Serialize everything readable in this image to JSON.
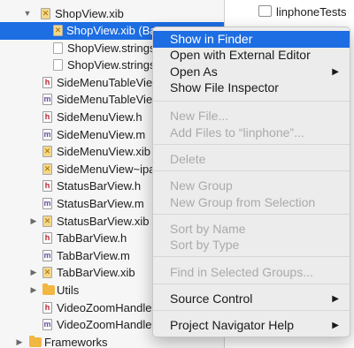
{
  "navigator": {
    "rows": [
      {
        "label": "ShopView.xib",
        "icon": "xib",
        "disclosure": "open"
      },
      {
        "label": "ShopView.xib (Bas",
        "icon": "xib",
        "selected": true
      },
      {
        "label": "ShopView.strings (",
        "icon": "strings"
      },
      {
        "label": "ShopView.strings (",
        "icon": "strings"
      },
      {
        "label": "SideMenuTableView.h",
        "icon": "h"
      },
      {
        "label": "SideMenuTableView.m",
        "icon": "m"
      },
      {
        "label": "SideMenuView.h",
        "icon": "h"
      },
      {
        "label": "SideMenuView.m",
        "icon": "m"
      },
      {
        "label": "SideMenuView.xib",
        "icon": "xib"
      },
      {
        "label": "SideMenuView~ipad.",
        "icon": "xib"
      },
      {
        "label": "StatusBarView.h",
        "icon": "h"
      },
      {
        "label": "StatusBarView.m",
        "icon": "m"
      },
      {
        "label": "StatusBarView.xib",
        "icon": "xib",
        "disclosure": "closed"
      },
      {
        "label": "TabBarView.h",
        "icon": "h"
      },
      {
        "label": "TabBarView.m",
        "icon": "m"
      },
      {
        "label": "TabBarView.xib",
        "icon": "xib",
        "disclosure": "closed"
      },
      {
        "label": "Utils",
        "icon": "folder",
        "disclosure": "closed"
      },
      {
        "label": "VideoZoomHandler.h",
        "icon": "h"
      },
      {
        "label": "VideoZoomHandler.m",
        "icon": "m"
      },
      {
        "label": "Frameworks",
        "icon": "folder",
        "disclosure": "closed"
      }
    ]
  },
  "editor": {
    "linphone_tests_label": "linphoneTests"
  },
  "context_menu": {
    "items": [
      {
        "label": "Show in Finder",
        "state": "highlight"
      },
      {
        "label": "Open with External Editor",
        "state": "enabled"
      },
      {
        "label": "Open As",
        "state": "enabled",
        "submenu": true
      },
      {
        "label": "Show File Inspector",
        "state": "enabled"
      },
      {
        "type": "separator"
      },
      {
        "label": "New File...",
        "state": "disabled"
      },
      {
        "label": "Add Files to “linphone”...",
        "state": "disabled"
      },
      {
        "type": "separator"
      },
      {
        "label": "Delete",
        "state": "disabled"
      },
      {
        "type": "separator"
      },
      {
        "label": "New Group",
        "state": "disabled"
      },
      {
        "label": "New Group from Selection",
        "state": "disabled"
      },
      {
        "type": "separator"
      },
      {
        "label": "Sort by Name",
        "state": "disabled"
      },
      {
        "label": "Sort by Type",
        "state": "disabled"
      },
      {
        "type": "separator"
      },
      {
        "label": "Find in Selected Groups...",
        "state": "disabled"
      },
      {
        "type": "separator"
      },
      {
        "label": "Source Control",
        "state": "enabled",
        "submenu": true
      },
      {
        "type": "separator"
      },
      {
        "label": "Project Navigator Help",
        "state": "enabled",
        "submenu": true
      }
    ]
  },
  "icons": {
    "disclosure_open": "▼",
    "disclosure_closed": "▶",
    "submenu_arrow": "▶",
    "h_glyph": "h",
    "m_glyph": "m",
    "xib_glyph": "✕"
  },
  "colors": {
    "selection": "#1d6de3",
    "disabled_text": "#aaaaaa",
    "header_icon_red": "#b5262d",
    "source_icon_purple": "#6b4fa3",
    "xib_icon": "#f3d88a",
    "folder": "#f2b643"
  }
}
